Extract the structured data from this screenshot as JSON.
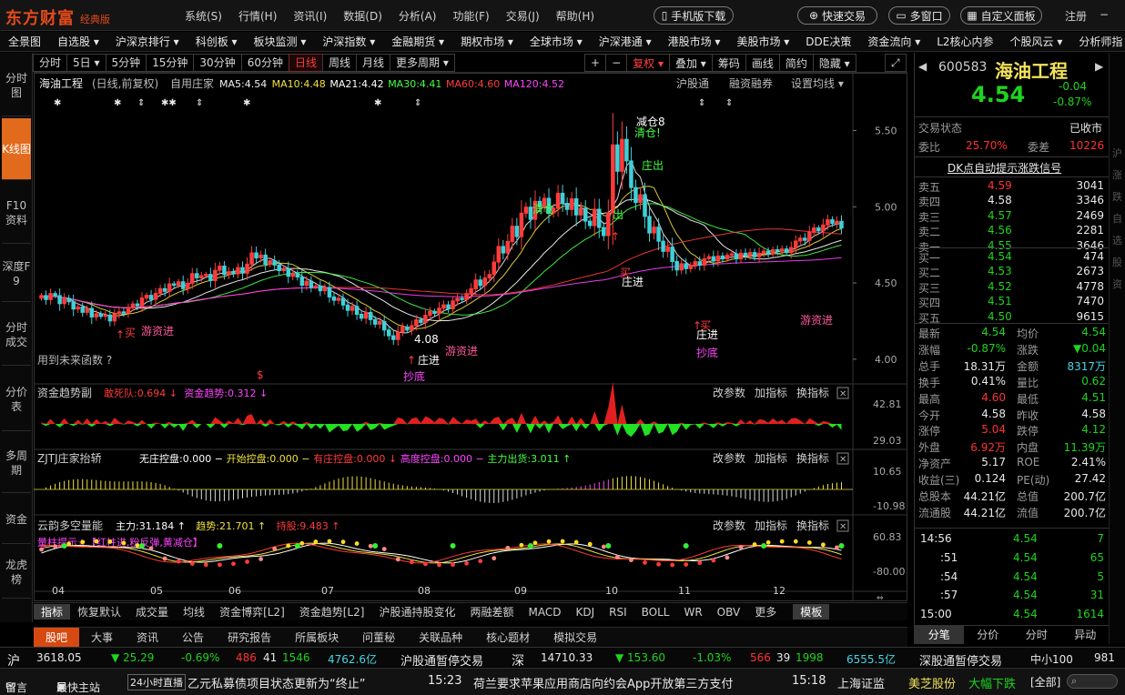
{
  "app": {
    "logo": "东方财富",
    "edition": "经典版"
  },
  "menu": [
    "系统(S)",
    "行情(H)",
    "资讯(I)",
    "数据(D)",
    "分析(A)",
    "功能(F)",
    "交易(J)",
    "帮助(H)"
  ],
  "top_buttons": {
    "mobile": "手机版下载",
    "quick_trade": "快速交易",
    "multi_window": "多窗口",
    "custom_panel": "自定义面板",
    "login": "注册"
  },
  "nav2": [
    "全景图",
    "自选股 ▾",
    "沪深京排行 ▾",
    "科创板 ▾",
    "板块监测 ▾",
    "沪深指数 ▾",
    "金融期货 ▾",
    "期权市场 ▾",
    "全球市场 ▾",
    "沪深港通 ▾",
    "港股市场 ▾",
    "美股市场 ▾",
    "DDE决策",
    "资金流向 ▾",
    "L2核心内参",
    "个股风云 ▾",
    "分析师指"
  ],
  "sidebar": [
    {
      "label": "分时图",
      "active": false
    },
    {
      "label": "K线图",
      "active": true
    },
    {
      "label": "F10资料",
      "active": false
    },
    {
      "label": "深度F9",
      "active": false
    },
    {
      "label": "分时成交",
      "active": false
    },
    {
      "label": "分价表",
      "active": false
    },
    {
      "label": "多周期",
      "active": false
    },
    {
      "label": "资金",
      "active": false
    },
    {
      "label": "龙虎榜",
      "active": false
    }
  ],
  "periods": [
    "分时",
    "5日 ▾",
    "5分钟",
    "15分钟",
    "30分钟",
    "60分钟",
    "日线",
    "周线",
    "月线",
    "更多周期 ▾"
  ],
  "active_period": "日线",
  "chart_tools": [
    "+",
    "−",
    "复权 ▾",
    "叠加 ▾",
    "筹码",
    "画线",
    "简约",
    "隐藏 ▾"
  ],
  "stock": {
    "code": "600583",
    "name": "海油工程",
    "price": "4.54",
    "change": "-0.04",
    "pct": "-0.87%"
  },
  "main_legend": {
    "title": "海油工程",
    "sub": "(日线,前复权)",
    "tag": "自用庄家",
    "ma": [
      {
        "label": "MA5:4.54",
        "color": "#f0f0f0"
      },
      {
        "label": "MA10:4.48",
        "color": "#f0e040"
      },
      {
        "label": "MA21:4.42",
        "color": "#ffffff"
      },
      {
        "label": "MA30:4.41",
        "color": "#44ff44"
      },
      {
        "label": "MA60:4.60",
        "color": "#ff3b3b"
      },
      {
        "label": "MA120:4.52",
        "color": "#ff44ff"
      }
    ],
    "right": [
      "沪股通",
      "融资融券",
      "设置均线 ▾"
    ]
  },
  "chart_notes": {
    "future": "用到未来函数 ?",
    "buy1": "买",
    "buy1b": "游资进",
    "buy1c": "4.08",
    "buy2": "庄进",
    "buy3": "游资进",
    "chaodi1": "抄底",
    "qingcang1": "清仓",
    "chu1": "出",
    "qingcang2": "清仓!",
    "top": "减仓8",
    "zhuangchu": "庄出",
    "zhuangjin2": "庄进",
    "zhuangjin3": "庄进",
    "chaodi2": "抄底",
    "youzijin4": "游资进",
    "mai": "买",
    "mai2": "买"
  },
  "panels": [
    {
      "id": "p1",
      "title": "资金趋势副",
      "items": [
        {
          "t": "敢死队:0.694 ↓",
          "c": "#ff3b3b"
        },
        {
          "t": "资金趋势:0.312 ↓",
          "c": "#ff44ff"
        }
      ],
      "tools": [
        "改参数",
        "加指标",
        "换指标"
      ]
    },
    {
      "id": "p2",
      "title": "ZJTJ庄家抬轿",
      "items": [
        {
          "t": "无庄控盘:0.000 −",
          "c": "#ffffff"
        },
        {
          "t": "开始控盘:0.000 −",
          "c": "#f0e040"
        },
        {
          "t": "有庄控盘:0.000 ↓",
          "c": "#ff3b3b"
        },
        {
          "t": "高度控盘:0.000 −",
          "c": "#ff44ff"
        },
        {
          "t": "主力出货:3.011 ↑",
          "c": "#44ff44"
        }
      ],
      "tools": [
        "改参数",
        "加指标",
        "换指标"
      ]
    },
    {
      "id": "p3",
      "title": "云韵多空量能",
      "items": [
        {
          "t": "主力:31.184 ↑",
          "c": "#ffffff"
        },
        {
          "t": "趋势:21.701 ↑",
          "c": "#f0e040"
        },
        {
          "t": "持股:9.483 ↑",
          "c": "#ff3b3b"
        }
      ],
      "tools": [
        "改参数",
        "加指标",
        "换指标"
      ],
      "hint": "量柱提示☆【红柱进,粉反弹,黄减仓】"
    }
  ],
  "axis": {
    "main": [
      "5.50",
      "5.00",
      "4.50",
      "4.00"
    ],
    "p1": [
      "42.81",
      "29.03"
    ],
    "p2": [
      "10.65",
      "-10.98"
    ],
    "p3": [
      "60.83",
      "-80.00"
    ],
    "months": [
      "04",
      "05",
      "06",
      "07",
      "08",
      "09",
      "10",
      "11",
      "12"
    ]
  },
  "chart_data": {
    "type": "candlestick",
    "ylim": [
      3.85,
      5.7
    ],
    "start_price": 4.4,
    "daily_returns_pct": [
      0.4,
      -0.6,
      0.9,
      -0.3,
      -1.2,
      0.8,
      -0.5,
      -1.1,
      0.3,
      -0.8,
      0.6,
      -1.3,
      0.5,
      -0.4,
      0.2,
      -0.9,
      1.1,
      0.3,
      -0.2,
      0.8,
      0.6,
      -0.3,
      1.2,
      0.4,
      -0.6,
      0.9,
      0.7,
      -0.4,
      1.1,
      -0.2,
      0.5,
      -1.0,
      0.8,
      1.4,
      -0.6,
      0.3,
      0.2,
      -0.9,
      1.5,
      0.6,
      -1.2,
      0.4,
      -0.3,
      0.9,
      -0.8,
      1.3,
      1.6,
      -0.7,
      0.4,
      -1.3,
      0.5,
      -0.6,
      -0.8,
      0.3,
      -1.1,
      0.4,
      -0.5,
      -1.2,
      0.6,
      -0.9,
      0.2,
      -0.7,
      0.5,
      -1.4,
      -0.5,
      0.3,
      -1.0,
      -0.8,
      0.6,
      -1.2,
      -0.6,
      0.9,
      -1.1,
      -0.7,
      0.4,
      -1.3,
      -0.9,
      -0.6,
      1.2,
      0.8,
      -0.5,
      0.7,
      0.9,
      -0.4,
      1.1,
      0.6,
      -0.3,
      0.8,
      0.5,
      -0.6,
      1.2,
      0.4,
      -0.2,
      0.9,
      0.7,
      1.3,
      -0.8,
      1.1,
      0.5,
      1.8,
      2.2,
      -0.9,
      1.6,
      2.1,
      -1.4,
      3.2,
      0.8,
      -1.6,
      2.4,
      -0.7,
      1.1,
      -1.9,
      0.6,
      2.0,
      -1.3,
      -0.8,
      1.4,
      -2.1,
      0.9,
      -1.7,
      -0.6,
      2.2,
      -2.4,
      -1.1,
      3.1,
      9.0,
      -3.2,
      4.0,
      -2.6,
      -3.3,
      -1.9,
      1.0,
      -2.8,
      -2.2,
      0.8,
      -1.9,
      -1.4,
      0.6,
      -2.0,
      -1.2,
      0.9,
      -0.7,
      0.4,
      0.6,
      -0.5,
      0.9,
      0.3,
      -0.6,
      0.7,
      -0.4,
      0.5,
      0.2,
      -0.7,
      0.8,
      -0.3,
      0.4,
      -0.6,
      0.5,
      0.3,
      -0.4,
      0.6,
      -0.2,
      0.3,
      -0.5,
      0.7,
      0.9,
      0.4,
      -0.3,
      1.1,
      0.6,
      -0.4,
      0.8,
      0.7,
      -0.5,
      0.3,
      -0.9
    ]
  },
  "quote": {
    "trade_status_label": "交易状态",
    "trade_status": "已收市",
    "weibi_label": "委比",
    "weibi": "25.70%",
    "weicha_label": "委差",
    "weicha": "10226",
    "dk_title": "DK点自动提示涨跌信号",
    "asks": [
      {
        "l": "卖五",
        "p": "4.59",
        "v": "3041",
        "c": "red"
      },
      {
        "l": "卖四",
        "p": "4.58",
        "v": "3346",
        "c": "white"
      },
      {
        "l": "卖三",
        "p": "4.57",
        "v": "2469",
        "c": "green"
      },
      {
        "l": "卖二",
        "p": "4.56",
        "v": "2281",
        "c": "green"
      },
      {
        "l": "卖一",
        "p": "4.55",
        "v": "3646",
        "c": "green"
      }
    ],
    "bids": [
      {
        "l": "买一",
        "p": "4.54",
        "v": "474",
        "c": "green"
      },
      {
        "l": "买二",
        "p": "4.53",
        "v": "2673",
        "c": "green"
      },
      {
        "l": "买三",
        "p": "4.52",
        "v": "4778",
        "c": "green"
      },
      {
        "l": "买四",
        "p": "4.51",
        "v": "7470",
        "c": "green"
      },
      {
        "l": "买五",
        "p": "4.50",
        "v": "9615",
        "c": "green"
      }
    ],
    "stats": [
      {
        "a": "最新",
        "av": "4.54",
        "ac": "green",
        "b": "均价",
        "bv": "4.54",
        "bc": "green"
      },
      {
        "a": "涨幅",
        "av": "-0.87%",
        "ac": "green",
        "b": "涨跌",
        "bv": "▼0.04",
        "bc": "green"
      },
      {
        "a": "总手",
        "av": "18.31万",
        "ac": "white",
        "b": "金额",
        "bv": "8317万",
        "bc": "cyan"
      },
      {
        "a": "换手",
        "av": "0.41%",
        "ac": "white",
        "b": "量比",
        "bv": "0.62",
        "bc": "green"
      },
      {
        "a": "最高",
        "av": "4.60",
        "ac": "red",
        "b": "最低",
        "bv": "4.51",
        "bc": "green"
      },
      {
        "a": "今开",
        "av": "4.58",
        "ac": "white",
        "b": "昨收",
        "bv": "4.58",
        "bc": "white"
      },
      {
        "a": "涨停",
        "av": "5.04",
        "ac": "red",
        "b": "跌停",
        "bv": "4.12",
        "bc": "green"
      },
      {
        "a": "外盘",
        "av": "6.92万",
        "ac": "red",
        "b": "内盘",
        "bv": "11.39万",
        "bc": "green"
      },
      {
        "a": "净资产",
        "av": "5.17",
        "ac": "white",
        "b": "ROE",
        "bv": "2.41%",
        "bc": "white"
      },
      {
        "a": "收益(三)",
        "av": "0.124",
        "ac": "white",
        "b": "PE(动)",
        "bv": "27.42",
        "bc": "white"
      },
      {
        "a": "总股本",
        "av": "44.21亿",
        "ac": "white",
        "b": "总值",
        "bv": "200.7亿",
        "bc": "white"
      },
      {
        "a": "流通股",
        "av": "44.21亿",
        "ac": "white",
        "b": "流值",
        "bv": "200.7亿",
        "bc": "white"
      }
    ],
    "ticks": [
      {
        "t": "14:56",
        "p": "4.54",
        "v": "7",
        "c": "green"
      },
      {
        "t": ":51",
        "p": "4.54",
        "v": "65",
        "c": "green"
      },
      {
        "t": ":54",
        "p": "4.54",
        "v": "5",
        "c": "green"
      },
      {
        "t": ":57",
        "p": "4.54",
        "v": "31",
        "c": "green"
      },
      {
        "t": "15:00",
        "p": "4.54",
        "v": "1614",
        "c": "green"
      }
    ],
    "bottom_tabs": [
      "分笔",
      "分价",
      "分时",
      "异动"
    ],
    "margin_text": [
      "沪",
      "涨",
      "跌",
      "自",
      "选",
      "股",
      "资"
    ]
  },
  "bottom_tabs": [
    "股吧",
    "大事",
    "资讯",
    "公告",
    "研究报告",
    "所属板块",
    "问董秘",
    "关联品种",
    "核心题材",
    "模拟交易"
  ],
  "indicator_bar": [
    "指标",
    "恢复默认",
    "成交量",
    "均线",
    "资金博弈[L2]",
    "资金趋势[L2]",
    "沪股通持股变化",
    "两融差额",
    "MACD",
    "KDJ",
    "RSI",
    "BOLL",
    "WR",
    "OBV",
    "更多",
    "模板"
  ],
  "status1": {
    "sh": "沪",
    "sh_idx": "3618.05",
    "sh_chg": "▼ 25.29",
    "sh_pct": "-0.69%",
    "sh_up": "486",
    "sh_flat": "41",
    "sh_down": "1546",
    "sh_amt": "4762.6亿",
    "sh_hk": "沪股通暂停交易",
    "sz": "深",
    "sz_idx": "14710.33",
    "sz_chg": "▼ 153.60",
    "sz_pct": "-1.03%",
    "sz_up": "566",
    "sz_flat": "39",
    "sz_down": "1998",
    "sz_amt": "6555.5亿",
    "sz_hk": "深股通暂停交易",
    "zxb": "中小100",
    "zxb_v": "981"
  },
  "status2": {
    "msg": "留言",
    "main": "最快主站",
    "live": "24小时直播",
    "news1": "乙元私募债项目状态更新为“终止”",
    "t2": "15:23",
    "news2": "荷兰要求苹果应用商店向约会App开放第三方支付",
    "t3": "15:18",
    "news3": "上海证监",
    "stock": "美芝股份",
    "stock_msg": "大幅下跌",
    "all": "[全部]"
  }
}
